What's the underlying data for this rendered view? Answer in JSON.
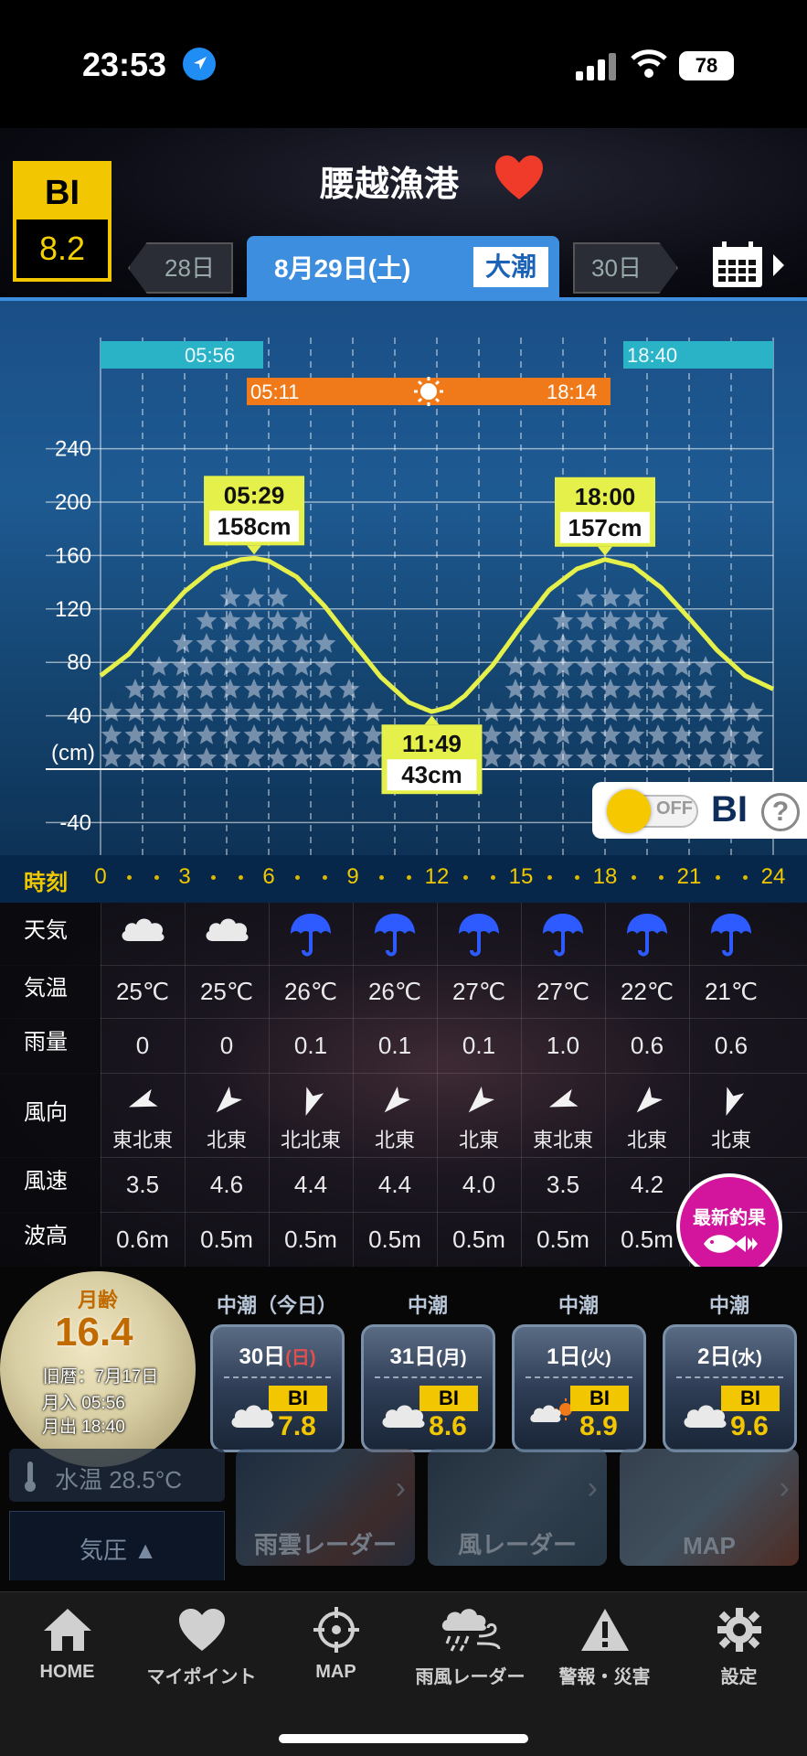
{
  "status": {
    "time": "23:53",
    "battery": "78"
  },
  "header": {
    "bi_label": "BI",
    "bi_value": "8.2",
    "spot_name": "腰越漁港",
    "prev_day": "28日",
    "date": "8月29日(土)",
    "tide_type": "大潮",
    "next_day": "30日"
  },
  "tide_chart": {
    "moonrise": "05:56",
    "moonset": "18:40",
    "sunrise": "05:11",
    "sunset": "18:14",
    "unit_label": "(cm)",
    "y_ticks": [
      "240",
      "200",
      "160",
      "120",
      "80",
      "40",
      "-40"
    ],
    "extremes": [
      {
        "time": "05:29",
        "height": "158cm",
        "type": "high"
      },
      {
        "time": "11:49",
        "height": "43cm",
        "type": "low"
      },
      {
        "time": "18:00",
        "height": "157cm",
        "type": "high"
      }
    ],
    "bi_toggle": {
      "state": "OFF",
      "label": "BI",
      "help": "?"
    }
  },
  "chart_data": {
    "type": "line",
    "xlabel": "時刻",
    "ylabel": "(cm)",
    "x_ticks": [
      0,
      3,
      6,
      9,
      12,
      15,
      18,
      21,
      24
    ],
    "ylim": [
      -60,
      260
    ],
    "series": [
      {
        "x": [
          0,
          1,
          2,
          3,
          4,
          5,
          5.48,
          6,
          7,
          8,
          9,
          10,
          11,
          11.82,
          12.5,
          13,
          14,
          15,
          16,
          17,
          18,
          19,
          20,
          21,
          22,
          23,
          24
        ],
        "y": [
          70,
          86,
          110,
          133,
          150,
          157,
          158,
          156,
          144,
          122,
          95,
          69,
          50,
          43,
          47,
          55,
          78,
          107,
          134,
          150,
          157,
          152,
          136,
          113,
          89,
          70,
          60
        ]
      }
    ],
    "extremes": [
      {
        "x": 5.48,
        "y": 158
      },
      {
        "x": 11.82,
        "y": 43
      },
      {
        "x": 18.0,
        "y": 157
      }
    ]
  },
  "time_axis": {
    "label": "時刻",
    "hours": [
      "0",
      "3",
      "6",
      "9",
      "12",
      "15",
      "18",
      "21",
      "24"
    ]
  },
  "weather": {
    "labels": {
      "weather": "天気",
      "temp": "気温",
      "rain": "雨量",
      "wind_dir": "風向",
      "wind_speed": "風速",
      "wave": "波高"
    },
    "columns": [
      {
        "icon": "cloud-icon",
        "temp": "25℃",
        "rain": "0",
        "wind_dir": "東北東",
        "wind_speed": "3.5",
        "wave": "0.6m",
        "arrow_angle": 250
      },
      {
        "icon": "cloud-icon",
        "temp": "25℃",
        "rain": "0",
        "wind_dir": "北東",
        "wind_speed": "4.6",
        "wave": "0.5m",
        "arrow_angle": 225
      },
      {
        "icon": "umbrella-icon",
        "temp": "26℃",
        "rain": "0.1",
        "wind_dir": "北北東",
        "wind_speed": "4.4",
        "wave": "0.5m",
        "arrow_angle": 200
      },
      {
        "icon": "umbrella-icon",
        "temp": "26℃",
        "rain": "0.1",
        "wind_dir": "北東",
        "wind_speed": "4.4",
        "wave": "0.5m",
        "arrow_angle": 225
      },
      {
        "icon": "umbrella-icon",
        "temp": "27℃",
        "rain": "0.1",
        "wind_dir": "北東",
        "wind_speed": "4.0",
        "wave": "0.5m",
        "arrow_angle": 225
      },
      {
        "icon": "umbrella-icon",
        "temp": "27℃",
        "rain": "1.0",
        "wind_dir": "東北東",
        "wind_speed": "3.5",
        "wave": "0.5m",
        "arrow_angle": 250
      },
      {
        "icon": "umbrella-icon",
        "temp": "22℃",
        "rain": "0.6",
        "wind_dir": "北東",
        "wind_speed": "4.2",
        "wave": "0.5m",
        "arrow_angle": 225
      },
      {
        "icon": "umbrella-icon",
        "temp": "21℃",
        "rain": "0.6",
        "wind_dir": "北東",
        "wind_speed": "",
        "wave": "",
        "arrow_angle": 200
      }
    ],
    "latest_catch": "最新釣果"
  },
  "moon": {
    "age_label": "月齢",
    "age": "16.4",
    "lunar_date": "旧暦：7月17日",
    "moonrise": "月入 05:56",
    "moonset": "月出 18:40"
  },
  "forecast": [
    {
      "tide": "中潮（今日）",
      "day": "30日",
      "weekday": "(日)",
      "weekday_color": "#e05050",
      "icon": "cloud-icon",
      "bi": "BI",
      "value": "7.8"
    },
    {
      "tide": "中潮",
      "day": "31日",
      "weekday": "(月)",
      "weekday_color": "#ffffff",
      "icon": "cloud-icon",
      "bi": "BI",
      "value": "8.6"
    },
    {
      "tide": "中潮",
      "day": "1日",
      "weekday": "(火)",
      "weekday_color": "#ffffff",
      "icon": "cloud-sun-icon",
      "bi": "BI",
      "value": "8.9"
    },
    {
      "tide": "中潮",
      "day": "2日",
      "weekday": "(水)",
      "weekday_color": "#ffffff",
      "icon": "cloud-icon",
      "bi": "BI",
      "value": "9.6"
    }
  ],
  "tools": {
    "water_temp": "水温 28.5°C",
    "pressure": "気圧 ▲",
    "rain_radar": "雨雲レーダー",
    "wind_radar": "風レーダー",
    "map": "MAP"
  },
  "tab_bar": [
    {
      "label": "HOME",
      "icon": "home-icon"
    },
    {
      "label": "マイポイント",
      "icon": "heart-icon"
    },
    {
      "label": "MAP",
      "icon": "crosshair-icon"
    },
    {
      "label": "雨風レーダー",
      "icon": "rain-wind-icon"
    },
    {
      "label": "警報・災害",
      "icon": "warning-icon"
    },
    {
      "label": "設定",
      "icon": "gear-icon"
    }
  ],
  "colors": {
    "accent": "#3e8ee0",
    "bi_yellow": "#f2c600",
    "tide_line": "#e6f04a",
    "sun_bar": "#f07a1a",
    "moon_bar": "#2ab3c6"
  }
}
